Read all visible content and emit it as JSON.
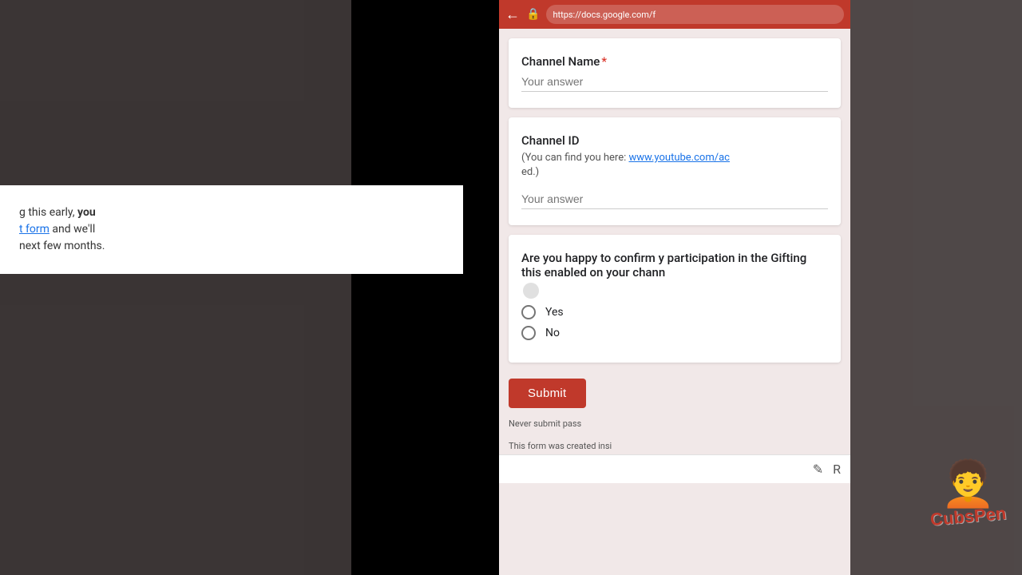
{
  "background": {
    "left_panel_color": "#6b6060",
    "right_panel_color": "#7a6e6e"
  },
  "left_card": {
    "text_part1": "g this early, ",
    "bold_text": "you",
    "text_part2": "\n",
    "link_text": "t form",
    "text_part3": " and we'll",
    "text_part4": "\nnext few months."
  },
  "browser": {
    "url": "https://docs.google.com/f"
  },
  "form": {
    "channel_name": {
      "label": "Channel Name",
      "required": true,
      "placeholder": "Your answer"
    },
    "channel_id": {
      "label": "Channel ID",
      "description": "(You can find you here: www.youtube.com/ac ed.)",
      "link_text": "www.youtube.com/ac",
      "link_suffix": "ed.",
      "placeholder": "Your answer"
    },
    "confirmation": {
      "label": "Are you happy to confirm y participation in the Gifting this enabled on your chann",
      "options": [
        "Yes",
        "No"
      ]
    },
    "submit_label": "Submit",
    "footer_text1": "Never submit pass",
    "footer_text2": "This form was created insi",
    "report_label": "R"
  },
  "watermark": {
    "text": "CubsPen"
  }
}
